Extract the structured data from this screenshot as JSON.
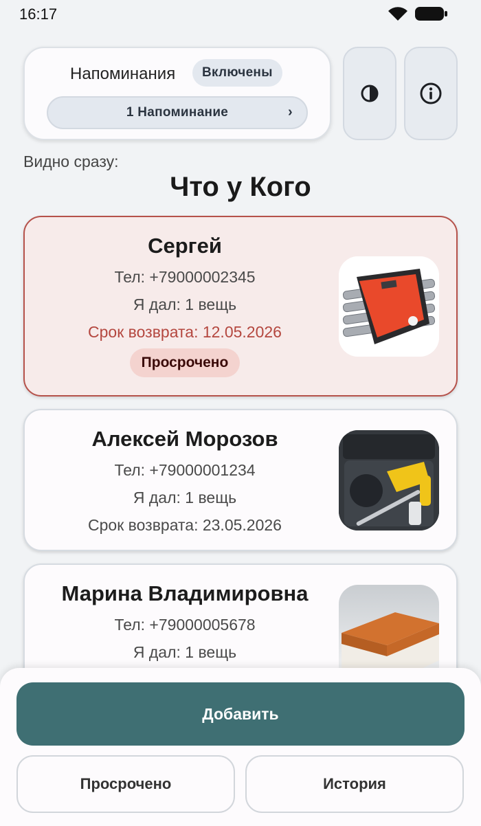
{
  "status_bar": {
    "time": "16:17",
    "icons": [
      "wifi-icon",
      "battery-icon"
    ]
  },
  "reminders": {
    "title": "Напоминания",
    "badge": "Включены",
    "selector_label": "1 Напоминание",
    "chevron": "›"
  },
  "toolbar": {
    "contrast_icon": "contrast-icon",
    "info_icon": "info-icon"
  },
  "visible_label": "Видно сразу:",
  "page_title": "Что у Кого",
  "cards": [
    {
      "name": "Сергей",
      "phone": "Тел: +79000002345",
      "given": "Я дал: 1 вещь",
      "due": "Срок возврата: 12.05.2026",
      "badge": "Просрочено",
      "overdue": true,
      "image": "wrench-set-image"
    },
    {
      "name": "Алексей Морозов",
      "phone": "Тел: +79000001234",
      "given": "Я дал: 1 вещь",
      "due": "Срок возврата: 23.05.2026",
      "overdue": false,
      "image": "hammer-drill-case-image"
    },
    {
      "name": "Марина Владимировна",
      "phone": "Тел: +79000005678",
      "given": "Я дал: 1 вещь",
      "overdue": false,
      "image": "book-image"
    }
  ],
  "bottom": {
    "add_label": "Добавить",
    "overdue_label": "Просрочено",
    "history_label": "История"
  },
  "colors": {
    "accent": "#3f6f73",
    "overdue_bg": "#f7ebea",
    "overdue_border": "#b5514a",
    "overdue_text": "#b4473f",
    "badge_bg": "#f4d3cf"
  }
}
